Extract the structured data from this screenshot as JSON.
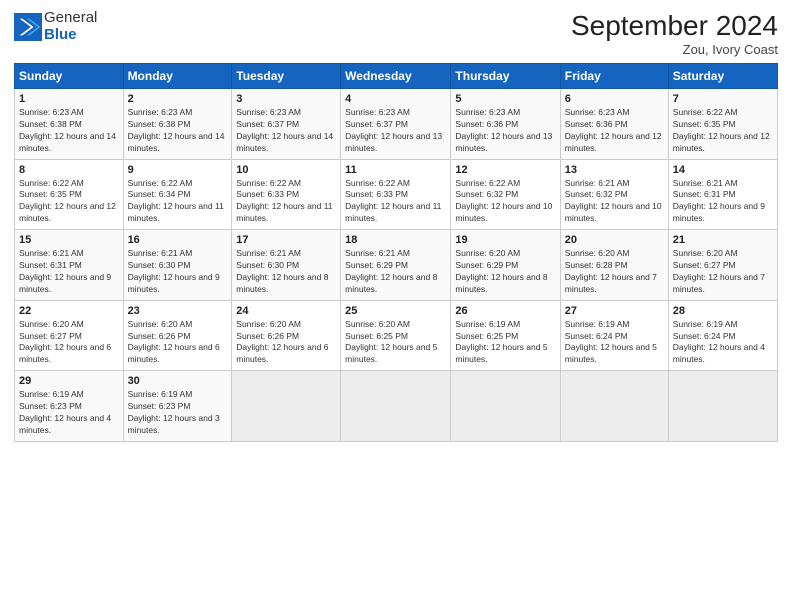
{
  "logo": {
    "general": "General",
    "blue": "Blue"
  },
  "title": "September 2024",
  "location": "Zou, Ivory Coast",
  "days_of_week": [
    "Sunday",
    "Monday",
    "Tuesday",
    "Wednesday",
    "Thursday",
    "Friday",
    "Saturday"
  ],
  "weeks": [
    [
      {
        "day": "1",
        "sunrise": "6:23 AM",
        "sunset": "6:38 PM",
        "daylight": "12 hours and 14 minutes."
      },
      {
        "day": "2",
        "sunrise": "6:23 AM",
        "sunset": "6:38 PM",
        "daylight": "12 hours and 14 minutes."
      },
      {
        "day": "3",
        "sunrise": "6:23 AM",
        "sunset": "6:37 PM",
        "daylight": "12 hours and 14 minutes."
      },
      {
        "day": "4",
        "sunrise": "6:23 AM",
        "sunset": "6:37 PM",
        "daylight": "12 hours and 13 minutes."
      },
      {
        "day": "5",
        "sunrise": "6:23 AM",
        "sunset": "6:36 PM",
        "daylight": "12 hours and 13 minutes."
      },
      {
        "day": "6",
        "sunrise": "6:23 AM",
        "sunset": "6:36 PM",
        "daylight": "12 hours and 12 minutes."
      },
      {
        "day": "7",
        "sunrise": "6:22 AM",
        "sunset": "6:35 PM",
        "daylight": "12 hours and 12 minutes."
      }
    ],
    [
      {
        "day": "8",
        "sunrise": "6:22 AM",
        "sunset": "6:35 PM",
        "daylight": "12 hours and 12 minutes."
      },
      {
        "day": "9",
        "sunrise": "6:22 AM",
        "sunset": "6:34 PM",
        "daylight": "12 hours and 11 minutes."
      },
      {
        "day": "10",
        "sunrise": "6:22 AM",
        "sunset": "6:33 PM",
        "daylight": "12 hours and 11 minutes."
      },
      {
        "day": "11",
        "sunrise": "6:22 AM",
        "sunset": "6:33 PM",
        "daylight": "12 hours and 11 minutes."
      },
      {
        "day": "12",
        "sunrise": "6:22 AM",
        "sunset": "6:32 PM",
        "daylight": "12 hours and 10 minutes."
      },
      {
        "day": "13",
        "sunrise": "6:21 AM",
        "sunset": "6:32 PM",
        "daylight": "12 hours and 10 minutes."
      },
      {
        "day": "14",
        "sunrise": "6:21 AM",
        "sunset": "6:31 PM",
        "daylight": "12 hours and 9 minutes."
      }
    ],
    [
      {
        "day": "15",
        "sunrise": "6:21 AM",
        "sunset": "6:31 PM",
        "daylight": "12 hours and 9 minutes."
      },
      {
        "day": "16",
        "sunrise": "6:21 AM",
        "sunset": "6:30 PM",
        "daylight": "12 hours and 9 minutes."
      },
      {
        "day": "17",
        "sunrise": "6:21 AM",
        "sunset": "6:30 PM",
        "daylight": "12 hours and 8 minutes."
      },
      {
        "day": "18",
        "sunrise": "6:21 AM",
        "sunset": "6:29 PM",
        "daylight": "12 hours and 8 minutes."
      },
      {
        "day": "19",
        "sunrise": "6:20 AM",
        "sunset": "6:29 PM",
        "daylight": "12 hours and 8 minutes."
      },
      {
        "day": "20",
        "sunrise": "6:20 AM",
        "sunset": "6:28 PM",
        "daylight": "12 hours and 7 minutes."
      },
      {
        "day": "21",
        "sunrise": "6:20 AM",
        "sunset": "6:27 PM",
        "daylight": "12 hours and 7 minutes."
      }
    ],
    [
      {
        "day": "22",
        "sunrise": "6:20 AM",
        "sunset": "6:27 PM",
        "daylight": "12 hours and 6 minutes."
      },
      {
        "day": "23",
        "sunrise": "6:20 AM",
        "sunset": "6:26 PM",
        "daylight": "12 hours and 6 minutes."
      },
      {
        "day": "24",
        "sunrise": "6:20 AM",
        "sunset": "6:26 PM",
        "daylight": "12 hours and 6 minutes."
      },
      {
        "day": "25",
        "sunrise": "6:20 AM",
        "sunset": "6:25 PM",
        "daylight": "12 hours and 5 minutes."
      },
      {
        "day": "26",
        "sunrise": "6:19 AM",
        "sunset": "6:25 PM",
        "daylight": "12 hours and 5 minutes."
      },
      {
        "day": "27",
        "sunrise": "6:19 AM",
        "sunset": "6:24 PM",
        "daylight": "12 hours and 5 minutes."
      },
      {
        "day": "28",
        "sunrise": "6:19 AM",
        "sunset": "6:24 PM",
        "daylight": "12 hours and 4 minutes."
      }
    ],
    [
      {
        "day": "29",
        "sunrise": "6:19 AM",
        "sunset": "6:23 PM",
        "daylight": "12 hours and 4 minutes."
      },
      {
        "day": "30",
        "sunrise": "6:19 AM",
        "sunset": "6:23 PM",
        "daylight": "12 hours and 3 minutes."
      },
      null,
      null,
      null,
      null,
      null
    ]
  ]
}
